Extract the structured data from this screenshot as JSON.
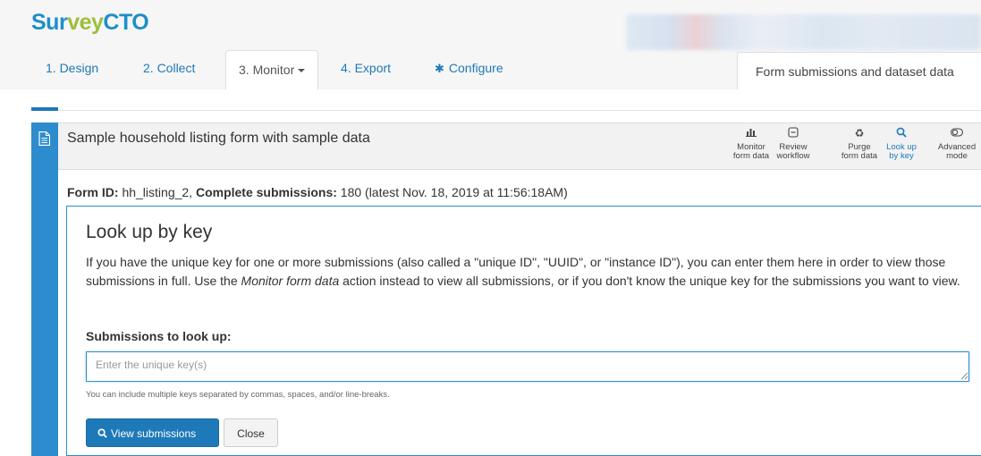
{
  "logo": {
    "part1": "Sur",
    "part2": "vey",
    "part3": "CTO"
  },
  "tabs": [
    {
      "label": "1. Design"
    },
    {
      "label": "2. Collect"
    },
    {
      "label": "3. Monitor"
    },
    {
      "label": "4. Export"
    },
    {
      "label": "Configure",
      "icon": "gear-icon"
    }
  ],
  "right_tab": "Form submissions and dataset data",
  "form": {
    "title": "Sample household listing form with sample data",
    "actions": [
      {
        "line1": "Monitor",
        "line2": "form data",
        "icon": "bar-chart-icon"
      },
      {
        "line1": "Review",
        "line2": "workflow",
        "icon": "review-icon"
      },
      {
        "line1": "Purge",
        "line2": "form data",
        "icon": "recycle-icon"
      },
      {
        "line1": "Look up",
        "line2": "by key",
        "icon": "search-icon",
        "active": true
      },
      {
        "line1": "Advanced",
        "line2": "mode",
        "icon": "toggle-icon"
      }
    ],
    "meta": {
      "id_label": "Form ID:",
      "id_value": " hh_listing_2, ",
      "complete_label": "Complete submissions:",
      "complete_value": " 180 (latest Nov. 18, 2019 at 11:56:18AM)"
    }
  },
  "lookup": {
    "heading": "Look up by key",
    "desc_part1": "If you have the unique key for one or more submissions (also called a \"unique ID\", \"UUID\", or \"instance ID\"), you can enter them here in order to view those submissions in full. Use the ",
    "desc_em": "Monitor form data",
    "desc_part2": " action instead to view all submissions, or if you don't know the unique key for the submissions you want to view.",
    "field_label": "Submissions to look up:",
    "placeholder": "Enter the unique key(s)",
    "help": "You can include multiple keys separated by commas, spaces, and/or line-breaks.",
    "view_button": "View submissions",
    "close_button": "Close"
  },
  "colors": {
    "accent": "#1e79b8",
    "sidebar": "#2d8ccd",
    "logo_green": "#9dbf3b"
  }
}
